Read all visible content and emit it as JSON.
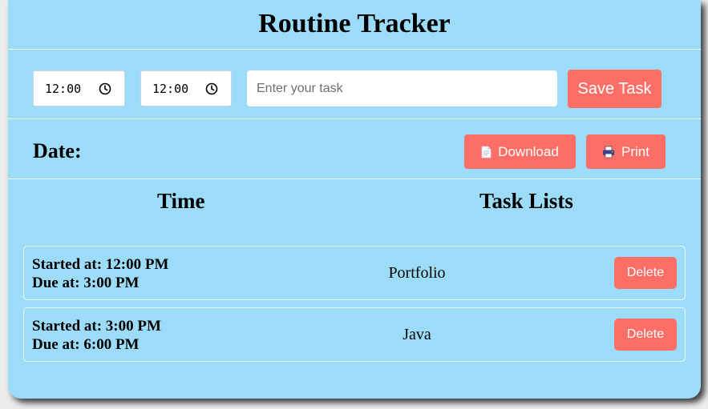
{
  "app": {
    "title": "Routine Tracker"
  },
  "form": {
    "start_time": "12:00",
    "end_time": "12:00",
    "task_placeholder": "Enter your task",
    "task_value": "",
    "save_label": "Save Task"
  },
  "toolbar": {
    "date_label": "Date:",
    "download_label": "Download",
    "download_icon": "document-icon",
    "print_label": "Print",
    "print_icon": "printer-icon"
  },
  "table": {
    "headers": [
      "Time",
      "Task Lists"
    ],
    "rows": [
      {
        "started": "Started at: 12:00 PM",
        "due": "Due at: 3:00 PM",
        "task": "Portfolio",
        "delete_label": "Delete"
      },
      {
        "started": "Started at: 3:00 PM",
        "due": "Due at: 6:00 PM",
        "task": "Java",
        "delete_label": "Delete"
      }
    ]
  },
  "colors": {
    "background": "#9ddcf8",
    "accent": "#fd6f66",
    "button_text": "#ffffff"
  }
}
